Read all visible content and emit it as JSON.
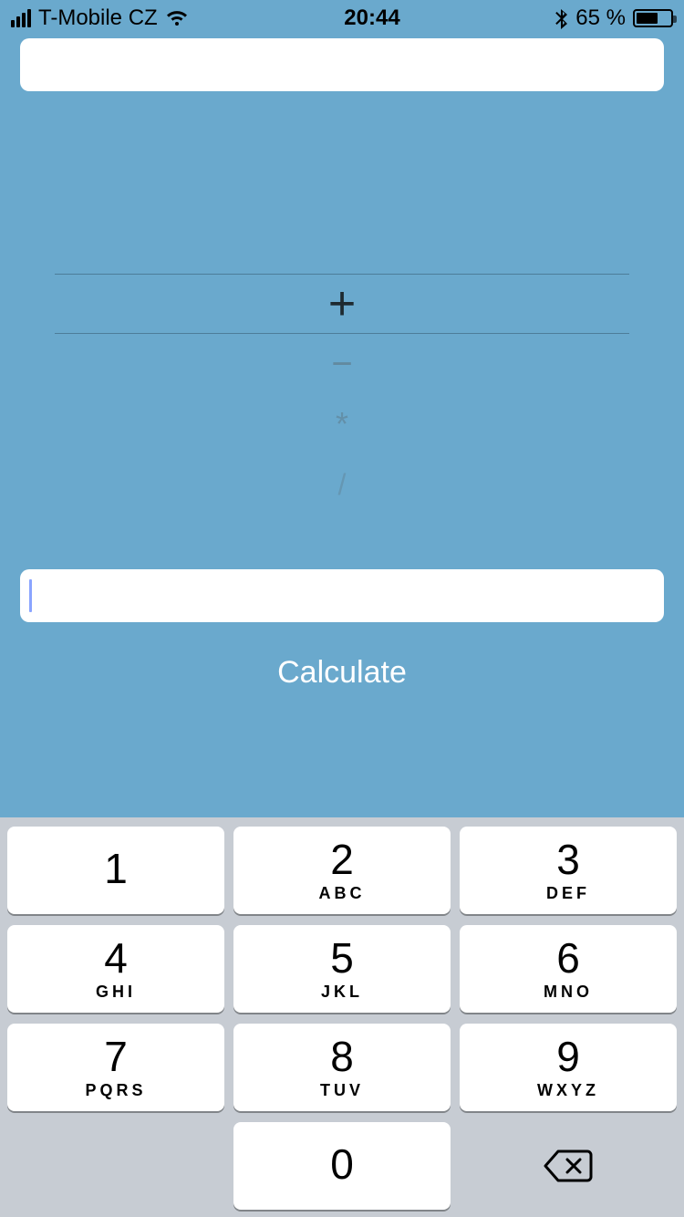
{
  "status_bar": {
    "carrier": "T-Mobile CZ",
    "time": "20:44",
    "battery_percent": "65 %",
    "battery_fill_pct": 65
  },
  "operators": {
    "selected": "+",
    "below1": "−",
    "below2": "*",
    "below3": "/"
  },
  "calculate_label": "Calculate",
  "input_top_value": "",
  "input_bottom_value": "",
  "keypad": {
    "k1": {
      "digit": "1",
      "letters": ""
    },
    "k2": {
      "digit": "2",
      "letters": "ABC"
    },
    "k3": {
      "digit": "3",
      "letters": "DEF"
    },
    "k4": {
      "digit": "4",
      "letters": "GHI"
    },
    "k5": {
      "digit": "5",
      "letters": "JKL"
    },
    "k6": {
      "digit": "6",
      "letters": "MNO"
    },
    "k7": {
      "digit": "7",
      "letters": "PQRS"
    },
    "k8": {
      "digit": "8",
      "letters": "TUV"
    },
    "k9": {
      "digit": "9",
      "letters": "WXYZ"
    },
    "k0": {
      "digit": "0",
      "letters": ""
    }
  }
}
